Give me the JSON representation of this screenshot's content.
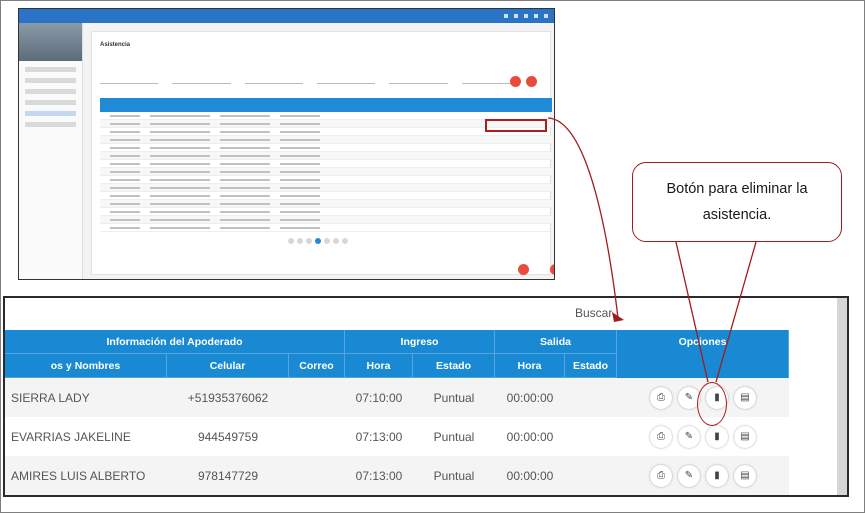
{
  "callout": {
    "text": "Botón para eliminar la asistencia."
  },
  "search_label": "Buscar",
  "table": {
    "group_headers": [
      "Información del Apoderado",
      "Ingreso",
      "Salida",
      "Opciones"
    ],
    "column_headers": [
      "os y Nombres",
      "Celular",
      "Correo",
      "Hora",
      "Estado",
      "Hora",
      "Estado"
    ],
    "rows": [
      {
        "name": "SIERRA LADY",
        "phone": "+51935376062",
        "email": "",
        "in_time": "07:10:00",
        "in_status": "Puntual",
        "out_time": "00:00:00",
        "out_status": ""
      },
      {
        "name": "EVARRIAS JAKELINE",
        "phone": "944549759",
        "email": "",
        "in_time": "07:13:00",
        "in_status": "Puntual",
        "out_time": "00:00:00",
        "out_status": ""
      },
      {
        "name": "AMIRES LUIS ALBERTO",
        "phone": "978147729",
        "email": "",
        "in_time": "07:13:00",
        "in_status": "Puntual",
        "out_time": "00:00:00",
        "out_status": ""
      }
    ]
  },
  "thumbnail": {
    "title": "Asistencia"
  },
  "colors": {
    "header_blue": "#1a89d4",
    "accent_red": "#b01c1c",
    "fab_red": "#e74c3c"
  },
  "icons": [
    "print-icon",
    "edit-icon",
    "delete-icon",
    "document-icon"
  ]
}
